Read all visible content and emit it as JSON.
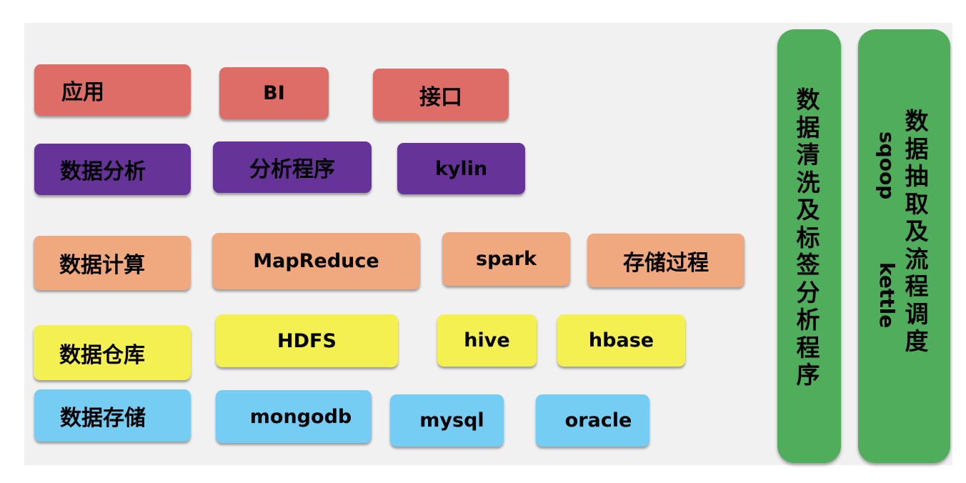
{
  "colors": {
    "background": "#ffffff",
    "panel": "#f1f1f1",
    "application": "#de6d67",
    "analysis": "#663399",
    "computation": "#f0a87e",
    "warehouse": "#f5f051",
    "storage": "#76cdf4",
    "side_process": "#4fad5b",
    "text": "#000000"
  },
  "layers": [
    {
      "name": "应用",
      "items": [
        "BI",
        "接口"
      ]
    },
    {
      "name": "数据分析",
      "items": [
        "分析程序",
        "kylin"
      ]
    },
    {
      "name": "数据计算",
      "items": [
        "MapReduce",
        "spark",
        "存储过程"
      ]
    },
    {
      "name": "数据仓库",
      "items": [
        "HDFS",
        "hive",
        "hbase"
      ]
    },
    {
      "name": "数据存储",
      "items": [
        "mongodb",
        "mysql",
        "oracle"
      ]
    }
  ],
  "side_bars": [
    {
      "title": "数据清洗及标签分析程序",
      "tools": []
    },
    {
      "title": "数据抽取及流程调度",
      "tools": [
        "sqoop",
        "kettle"
      ]
    }
  ]
}
